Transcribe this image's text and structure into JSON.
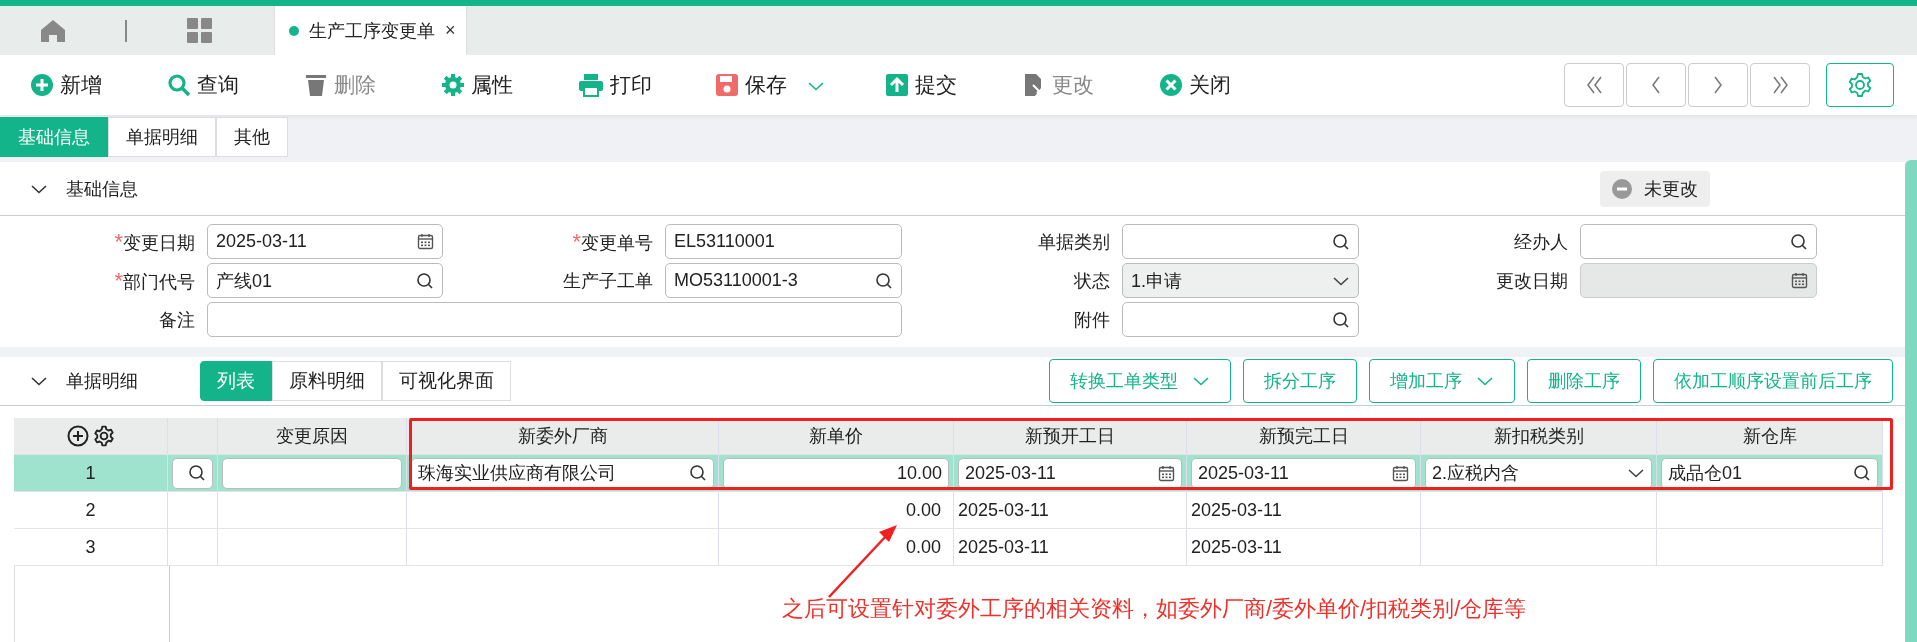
{
  "tab_bar": {
    "tabs": [
      {
        "label": "生产工序变更单",
        "selected": true,
        "close": "×"
      }
    ]
  },
  "toolbar": {
    "buttons": [
      {
        "label": "新增",
        "disabled": false,
        "dropdown": false
      },
      {
        "label": "查询",
        "disabled": false,
        "dropdown": false
      },
      {
        "label": "删除",
        "disabled": true,
        "dropdown": false
      },
      {
        "label": "属性",
        "disabled": false,
        "dropdown": false
      },
      {
        "label": "打印",
        "disabled": false,
        "dropdown": false
      },
      {
        "label": "保存",
        "disabled": false,
        "dropdown": true
      },
      {
        "label": "提交",
        "disabled": false,
        "dropdown": false
      },
      {
        "label": "更改",
        "disabled": true,
        "dropdown": false
      },
      {
        "label": "关闭",
        "disabled": false,
        "dropdown": false
      }
    ]
  },
  "section_tabs": [
    {
      "label": "基础信息",
      "selected": true
    },
    {
      "label": "单据明细",
      "selected": false
    },
    {
      "label": "其他",
      "selected": false
    }
  ],
  "basic_info": {
    "title": "基础信息",
    "status_badge": "未更改",
    "fields": [
      {
        "label": "变更日期",
        "required_mark": "*",
        "kind": "date",
        "value": "2025-03-11",
        "wide": false,
        "disabled": false
      },
      {
        "label": "变更单号",
        "required_mark": "*",
        "kind": "text",
        "value": "EL53110001",
        "wide": false,
        "disabled": false
      },
      {
        "label": "单据类别",
        "kind": "lookup",
        "wide": false,
        "disabled": false
      },
      {
        "label": "经办人",
        "kind": "lookup",
        "wide": false,
        "disabled": false
      },
      {
        "label": "部门代号",
        "required_mark": "*",
        "kind": "lookup",
        "value": "产线01",
        "wide": false,
        "disabled": false
      },
      {
        "label": "生产子工单",
        "kind": "lookup",
        "value": "MO53110001-3",
        "wide": false,
        "disabled": false
      },
      {
        "label": "状态",
        "kind": "select",
        "value": "1.申请",
        "wide": false,
        "disabled": false
      },
      {
        "label": "更改日期",
        "kind": "date",
        "wide": false,
        "disabled": true
      },
      {
        "label": "备注",
        "kind": "text",
        "wide": true,
        "disabled": false
      },
      {
        "label": "附件",
        "kind": "lookup",
        "wide": false,
        "disabled": false
      }
    ]
  },
  "details": {
    "title": "单据明细",
    "view_tabs": [
      {
        "label": "列表",
        "selected": true
      },
      {
        "label": "原料明细",
        "selected": false
      },
      {
        "label": "可视化界面",
        "selected": false
      }
    ],
    "actions": [
      {
        "label": "转换工单类型",
        "dropdown": true
      },
      {
        "label": "拆分工序",
        "dropdown": false
      },
      {
        "label": "增加工序",
        "dropdown": true
      },
      {
        "label": "删除工序",
        "dropdown": false
      },
      {
        "label": "依加工顺序设置前后工序",
        "dropdown": false
      }
    ],
    "table": {
      "columns": [
        "",
        "变更原因",
        "新委外厂商",
        "新单价",
        "新预开工日",
        "新预完工日",
        "新扣税类别",
        "新仓库"
      ],
      "rows": [
        {
          "number": "1",
          "selected": true,
          "cells": [
            {
              "kind": "lookup"
            },
            {
              "kind": "text"
            },
            {
              "kind": "lookup",
              "value": "珠海实业供应商有限公司"
            },
            {
              "kind": "number",
              "value": "10.00"
            },
            {
              "kind": "date",
              "value": "2025-03-11"
            },
            {
              "kind": "date",
              "value": "2025-03-11"
            },
            {
              "kind": "select",
              "value": "2.应税内含"
            },
            {
              "kind": "lookup",
              "value": "成品仓01"
            }
          ]
        },
        {
          "number": "2",
          "selected": false,
          "cells": [
            {
              "kind": "plain"
            },
            {
              "kind": "plain"
            },
            {
              "kind": "plain"
            },
            {
              "kind": "amount",
              "value": "0.00"
            },
            {
              "kind": "plain",
              "value": "2025-03-11"
            },
            {
              "kind": "plain",
              "value": "2025-03-11"
            },
            {
              "kind": "plain"
            },
            {
              "kind": "plain"
            }
          ]
        },
        {
          "number": "3",
          "selected": false,
          "cells": [
            {
              "kind": "plain"
            },
            {
              "kind": "plain"
            },
            {
              "kind": "plain"
            },
            {
              "kind": "amount",
              "value": "0.00"
            },
            {
              "kind": "plain",
              "value": "2025-03-11"
            },
            {
              "kind": "plain",
              "value": "2025-03-11"
            },
            {
              "kind": "plain"
            },
            {
              "kind": "plain"
            }
          ]
        }
      ]
    },
    "annotation": {
      "text": "之后可设置针对委外工序的相关资料，如委外厂商/委外单价/扣税类别/仓库等"
    }
  }
}
